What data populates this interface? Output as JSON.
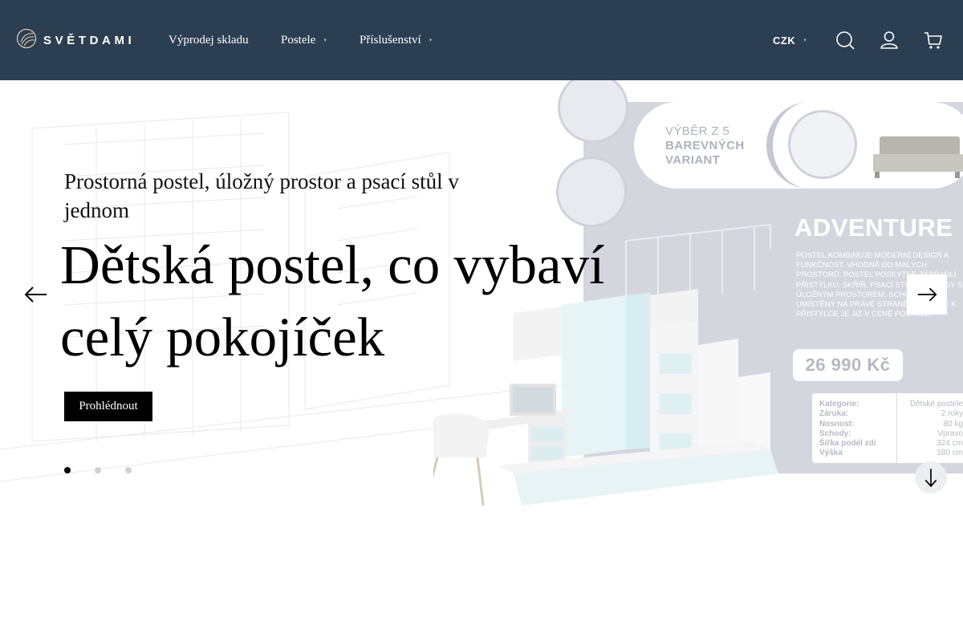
{
  "header": {
    "logo_text": "SVĚTDAMI",
    "nav": [
      {
        "label": "Výprodej skladu"
      },
      {
        "label": "Postele"
      },
      {
        "label": "Příslušenství"
      }
    ],
    "currency": "CZK",
    "icons": [
      "logo-mark-icon",
      "search-icon",
      "user-icon",
      "cart-icon"
    ]
  },
  "hero": {
    "subtitle": "Prostorná postel, úložný prostor a psací stůl v jednom",
    "headline": "Dětská postel, co vybaví celý pokojíček",
    "cta_label": "Prohlédnout",
    "slides": [
      {
        "active": true
      },
      {
        "active": false
      },
      {
        "active": false
      }
    ],
    "banner": {
      "variant_line1": "VÝBĚR Z 5",
      "variant_line2": "BAREVNÝCH",
      "variant_line3": "VARIANT",
      "product_name": "ADVENTURE",
      "description": "Postel kombinuje moderní design a funkčnost. Vhodná do malých prostorů. Postel poskytne zábradlí, přistýlku, skříň, psací stůl a schody s úložným prostorem. Schody jsou umístěny na pravé straně. Matrace k přistýlce je již v ceně postele.",
      "price": "26 990 Kč",
      "specs": [
        {
          "key": "Kategorie:",
          "value": "Dětské postele"
        },
        {
          "key": "Záruka:",
          "value": "2 roky"
        },
        {
          "key": "Nosnost:",
          "value": "80 kg"
        },
        {
          "key": "Schody:",
          "value": "Vpravo"
        },
        {
          "key": "Šířka podél zdi",
          "value": "324 cm"
        },
        {
          "key": "Výška",
          "value": "180 cm"
        }
      ]
    }
  },
  "colors": {
    "header_bg": "#2c3e52",
    "accent_black": "#000000",
    "dot_active": "#000000",
    "dot_inactive": "#d0d0d0"
  }
}
